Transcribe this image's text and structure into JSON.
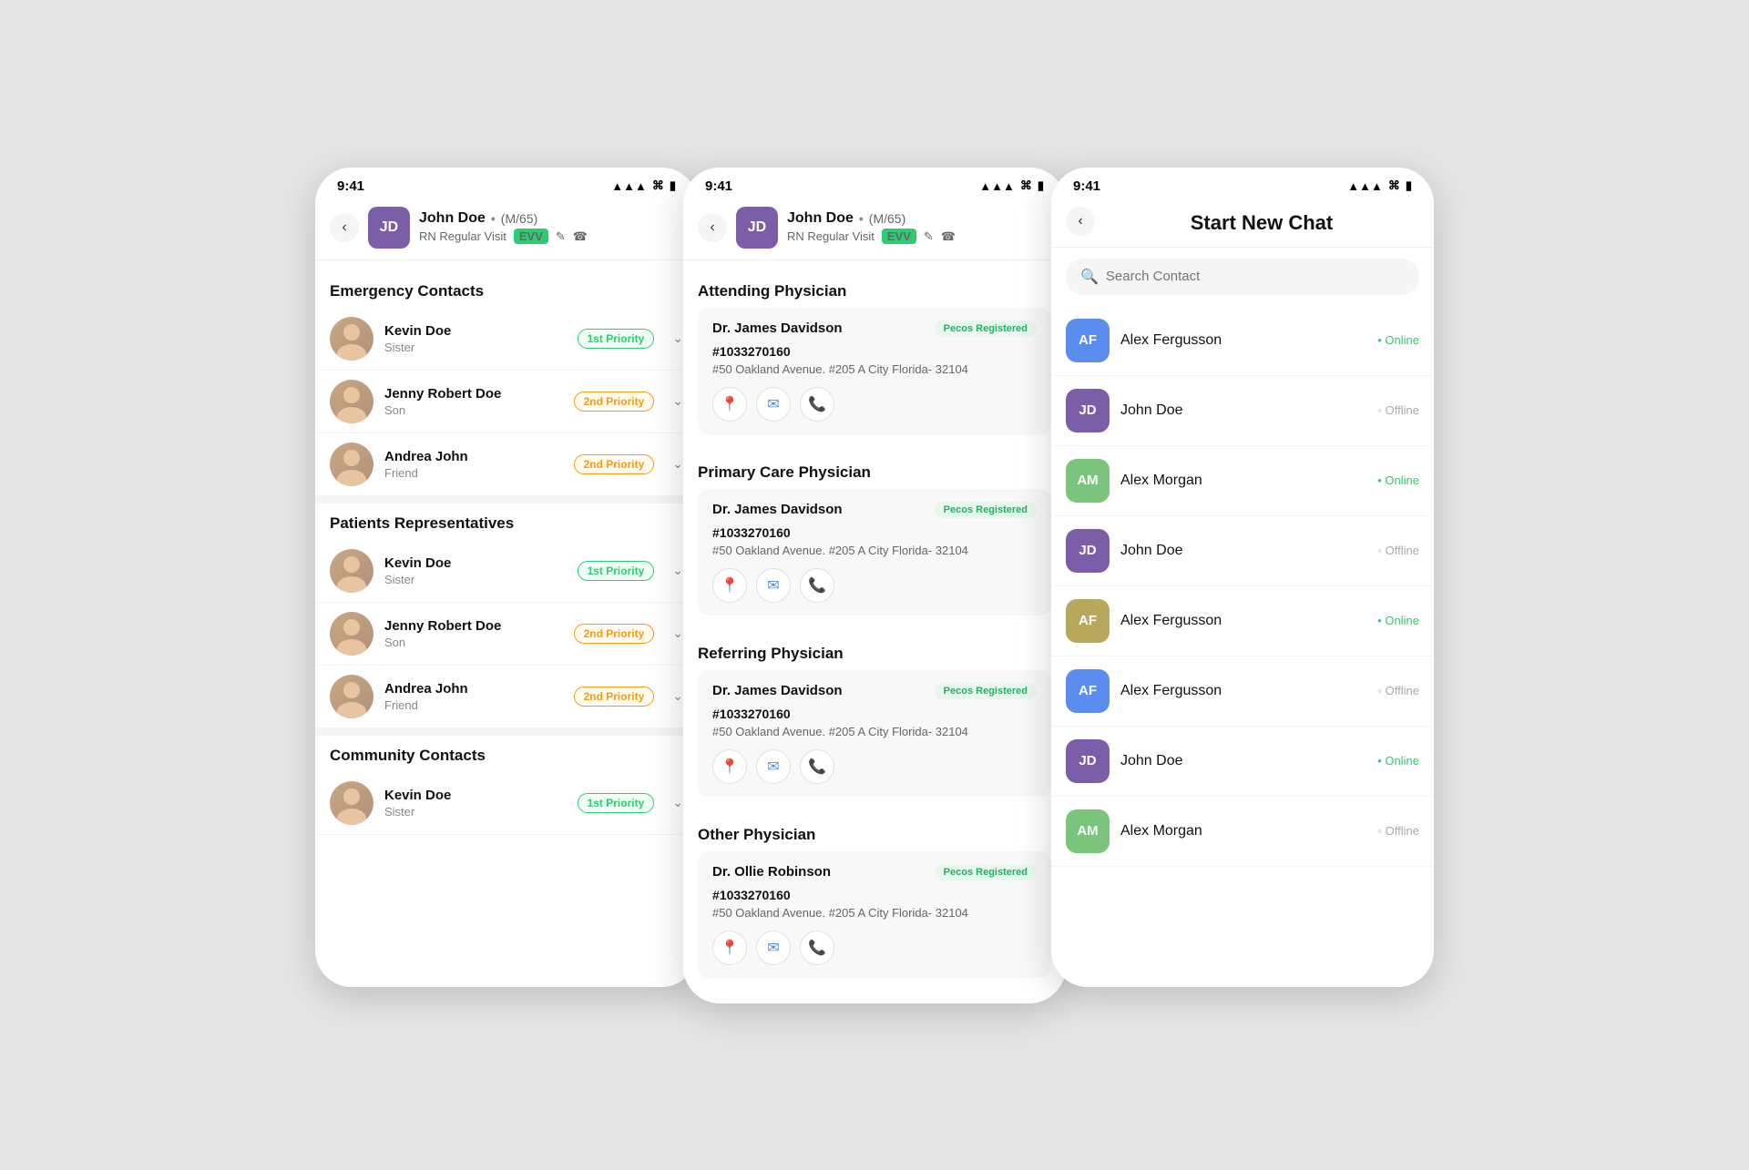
{
  "statusBar": {
    "time": "9:41",
    "signal": "▲▲▲▲",
    "wifi": "wifi",
    "battery": "🔋"
  },
  "panel1": {
    "patient": {
      "initials": "JD",
      "avatarColor": "#7b5ea7",
      "name": "John Doe",
      "dot": "•",
      "meta": "(M/65)",
      "visit": "RN Regular Visit",
      "evv": "EVV"
    },
    "sections": [
      {
        "title": "Emergency Contacts",
        "contacts": [
          {
            "name": "Kevin Doe",
            "relation": "Sister",
            "priority": "1st Priority",
            "priorityClass": "priority-1st"
          },
          {
            "name": "Jenny Robert Doe",
            "relation": "Son",
            "priority": "2nd Priority",
            "priorityClass": "priority-2nd"
          },
          {
            "name": "Andrea John",
            "relation": "Friend",
            "priority": "2nd Priority",
            "priorityClass": "priority-2nd"
          }
        ]
      },
      {
        "title": "Patients Representatives",
        "contacts": [
          {
            "name": "Kevin Doe",
            "relation": "Sister",
            "priority": "1st Priority",
            "priorityClass": "priority-1st"
          },
          {
            "name": "Jenny Robert Doe",
            "relation": "Son",
            "priority": "2nd Priority",
            "priorityClass": "priority-2nd"
          },
          {
            "name": "Andrea John",
            "relation": "Friend",
            "priority": "2nd Priority",
            "priorityClass": "priority-2nd"
          }
        ]
      },
      {
        "title": "Community Contacts",
        "contacts": [
          {
            "name": "Kevin Doe",
            "relation": "Sister",
            "priority": "1st Priority",
            "priorityClass": "priority-1st"
          }
        ]
      }
    ]
  },
  "panel2": {
    "patient": {
      "initials": "JD",
      "avatarColor": "#7b5ea7",
      "name": "John Doe",
      "meta": "(M/65)",
      "visit": "RN Regular Visit",
      "evv": "EVV"
    },
    "physicians": [
      {
        "section": "Attending Physician",
        "name": "Dr. James Davidson",
        "badge": "Pecos Registered",
        "phone": "#1033270160",
        "address": "#50 Oakland Avenue. #205 A City Florida- 32104"
      },
      {
        "section": "Primary Care Physician",
        "name": "Dr. James Davidson",
        "badge": "Pecos Registered",
        "phone": "#1033270160",
        "address": "#50 Oakland Avenue. #205 A City Florida- 32104"
      },
      {
        "section": "Referring Physician",
        "name": "Dr. James Davidson",
        "badge": "Pecos Registered",
        "phone": "#1033270160",
        "address": "#50 Oakland Avenue. #205 A City Florida- 32104"
      },
      {
        "section": "Other Physician",
        "name": "Dr. Ollie Robinson",
        "badge": "Pecos Registered",
        "phone": "#1033270160",
        "address": "#50 Oakland Avenue. #205 A City Florida- 32104"
      }
    ]
  },
  "panel3": {
    "title": "Start New Chat",
    "searchPlaceholder": "Search Contact",
    "contacts": [
      {
        "initials": "AF",
        "name": "Alex Fergusson",
        "status": "Online",
        "isOnline": true,
        "color": "#5b8def"
      },
      {
        "initials": "JD",
        "name": "John Doe",
        "status": "Offline",
        "isOnline": false,
        "color": "#7b5ea7"
      },
      {
        "initials": "AM",
        "name": "Alex Morgan",
        "status": "Online",
        "isOnline": true,
        "color": "#7bc47b"
      },
      {
        "initials": "JD",
        "name": "John Doe",
        "status": "Offline",
        "isOnline": false,
        "color": "#7b5ea7"
      },
      {
        "initials": "AF",
        "name": "Alex Fergusson",
        "status": "Online",
        "isOnline": true,
        "color": "#b8a85c"
      },
      {
        "initials": "AF",
        "name": "Alex Fergusson",
        "status": "Offline",
        "isOnline": false,
        "color": "#5b8def"
      },
      {
        "initials": "JD",
        "name": "John Doe",
        "status": "Online",
        "isOnline": true,
        "color": "#7b5ea7"
      },
      {
        "initials": "AM",
        "name": "Alex Morgan",
        "status": "Offline",
        "isOnline": false,
        "color": "#7bc47b"
      }
    ]
  }
}
